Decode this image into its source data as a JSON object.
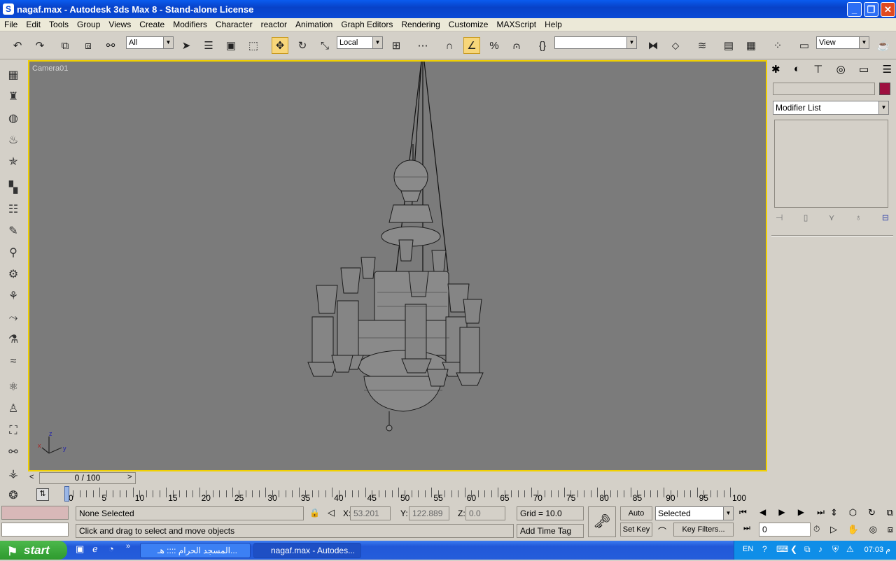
{
  "window": {
    "title": "nagaf.max - Autodesk 3ds Max 8  - Stand-alone License"
  },
  "menu": [
    "File",
    "Edit",
    "Tools",
    "Group",
    "Views",
    "Create",
    "Modifiers",
    "Character",
    "reactor",
    "Animation",
    "Graph Editors",
    "Rendering",
    "Customize",
    "MAXScript",
    "Help"
  ],
  "toolbar": {
    "selection_filter": "All",
    "ref_coord": "Local",
    "named_selection": "",
    "view_dropdown": "View"
  },
  "viewport": {
    "label": "Camera01",
    "axis_x": "x",
    "axis_y": "y",
    "axis_z": "z"
  },
  "command_panel": {
    "object_name": "",
    "color": "#9e1040",
    "modifier_list": "Modifier List"
  },
  "time_slider": {
    "position": "0 / 100",
    "ticks": [
      "0",
      "5",
      "10",
      "15",
      "20",
      "25",
      "30",
      "35",
      "40",
      "45",
      "50",
      "55",
      "60",
      "65",
      "70",
      "75",
      "80",
      "85",
      "90",
      "95",
      "100"
    ]
  },
  "status": {
    "selection": "None Selected",
    "x_label": "X:",
    "x_value": "53.201",
    "y_label": "Y:",
    "y_value": "122.889",
    "z_label": "Z:",
    "z_value": "0.0",
    "grid": "Grid = 10.0",
    "prompt": "Click and drag to select and move objects",
    "add_time_tag": "Add Time Tag",
    "auto_key": "Auto Key",
    "set_key": "Set Key",
    "key_mode": "Selected",
    "key_filters": "Key Filters...",
    "frame": "0"
  },
  "taskbar": {
    "start": "start",
    "tasks": [
      "المسجد الحرام :::: هـ...",
      "nagaf.max - Autodes..."
    ],
    "lang": "EN",
    "time": "07:03 م"
  }
}
